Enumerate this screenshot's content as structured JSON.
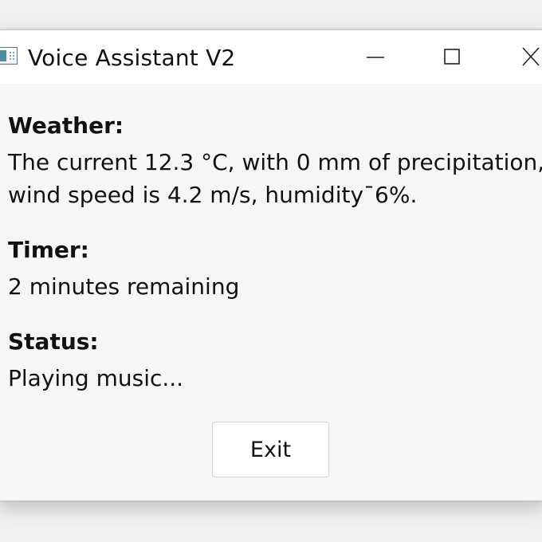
{
  "window": {
    "title": "Voice Assistant V2",
    "controls": {
      "minimize_icon": "minimize-icon",
      "maximize_icon": "maximize-icon",
      "close_icon": "close-icon"
    }
  },
  "weather": {
    "label": "Weather:",
    "line1": "The current 12.3 °C, with 0 mm of precipitation,",
    "line2": "wind speed is 4.2 m/s, humidity¯6%."
  },
  "timer": {
    "label": "Timer:",
    "text": "2 minutes remaining"
  },
  "status": {
    "label": "Status:",
    "text": "Playing music..."
  },
  "actions": {
    "exit_label": "Exit"
  }
}
